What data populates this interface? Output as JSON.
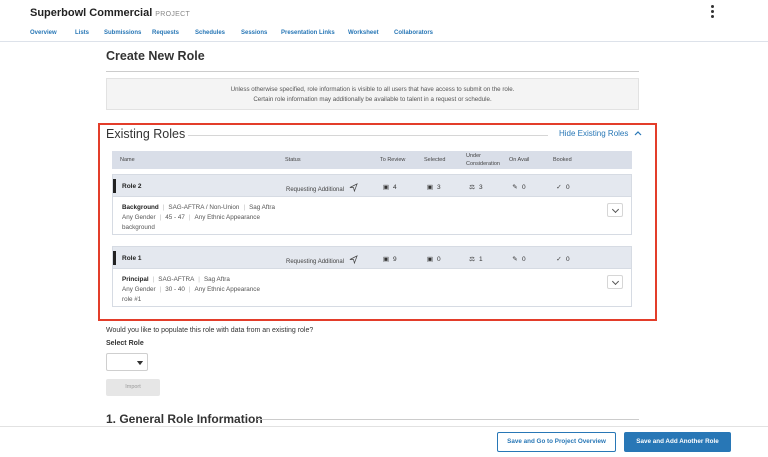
{
  "header": {
    "project_title": "Superbowl Commercial",
    "project_tag": "PROJECT"
  },
  "nav": {
    "tabs": [
      {
        "label": "Overview"
      },
      {
        "label": "Lists"
      },
      {
        "label": "Submissions"
      },
      {
        "label": "Requests"
      },
      {
        "label": "Schedules"
      },
      {
        "label": "Sessions"
      },
      {
        "label": "Presentation Links"
      },
      {
        "label": "Worksheet"
      },
      {
        "label": "Collaborators"
      }
    ]
  },
  "page": {
    "title": "Create New Role",
    "info_line1": "Unless otherwise specified, role information is visible to all users that have access to submit on the role.",
    "info_line2": "Certain role information may additionally be available to talent in a request or schedule."
  },
  "existing_roles": {
    "title": "Existing Roles",
    "hide_link": "Hide Existing Roles",
    "columns": {
      "name": "Name",
      "status": "Status",
      "to_review": "To Review",
      "selected": "Selected",
      "under_consideration_1": "Under",
      "under_consideration_2": "Consideration",
      "on_avail": "On Avail",
      "booked": "Booked"
    },
    "roles": [
      {
        "name": "Role 2",
        "status": "Requesting Additional",
        "to_review": "4",
        "selected": "3",
        "under_consideration": "3",
        "on_avail": "0",
        "booked": "0",
        "role_type": "Background",
        "union": "SAG-AFTRA / Non-Union",
        "union_detail": "Sag Aftra",
        "gender": "Any Gender",
        "age": "45 - 47",
        "ethnicity": "Any Ethnic Appearance",
        "description": "background"
      },
      {
        "name": "Role 1",
        "status": "Requesting Additional",
        "to_review": "9",
        "selected": "0",
        "under_consideration": "1",
        "on_avail": "0",
        "booked": "0",
        "role_type": "Principal",
        "union": "SAG-AFTRA",
        "union_detail": "Sag Aftra",
        "gender": "Any Gender",
        "age": "30 - 40",
        "ethnicity": "Any Ethnic Appearance",
        "description": "role #1"
      }
    ]
  },
  "populate": {
    "question": "Would you like to populate this role with data from an existing role?",
    "select_label": "Select Role",
    "selected_value": "",
    "import_label": "Import"
  },
  "general": {
    "title": "1. General Role Information"
  },
  "footer": {
    "save_overview": "Save and Go to Project Overview",
    "save_another": "Save and Add Another Role"
  },
  "colors": {
    "accent": "#2877b6",
    "highlight_frame": "#e33d2a"
  }
}
